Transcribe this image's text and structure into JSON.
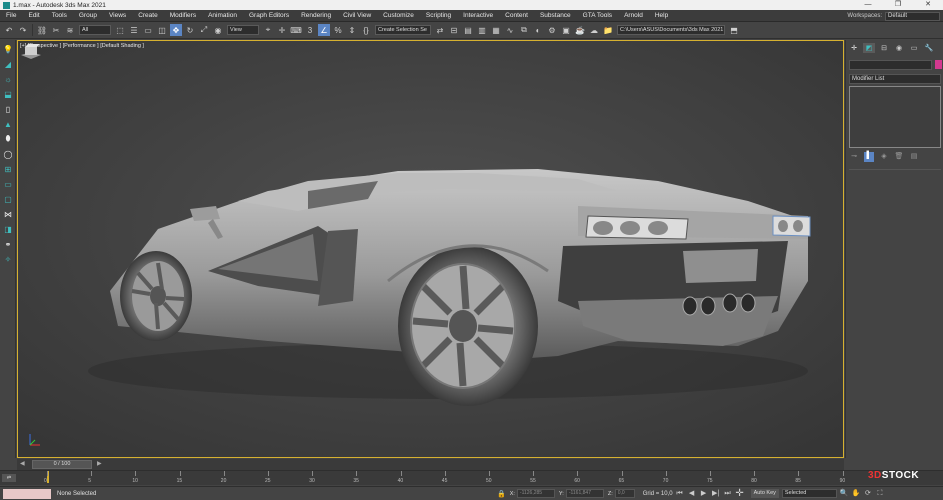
{
  "window": {
    "title": "1.max - Autodesk 3ds Max 2021",
    "controls": [
      "—",
      "❐",
      "✕"
    ]
  },
  "menu": {
    "items": [
      "File",
      "Edit",
      "Tools",
      "Group",
      "Views",
      "Create",
      "Modifiers",
      "Animation",
      "Graph Editors",
      "Rendering",
      "Civil View",
      "Customize",
      "Scripting",
      "Interactive",
      "Content",
      "Substance",
      "GTA Tools",
      "Arnold",
      "Help"
    ],
    "workspaces_label": "Workspaces:",
    "workspaces_value": "Default"
  },
  "toolbar": {
    "filter_select": "All",
    "ref_coord_select": "View",
    "named_selection": "Create Selection Se",
    "project_path": "C:\\Users\\ASUS\\Documents\\3ds Max 2021"
  },
  "viewport": {
    "label": "[+] [Perspective ] [Performance ] [Default Shading ]",
    "border_color": "#d6b130",
    "background": "#3e3e3e"
  },
  "command_panel": {
    "modifier_list": "Modifier List",
    "accent_swatch": "#d4398f"
  },
  "timeline": {
    "frame_display": "0 / 100",
    "ticks": [
      "0",
      "5",
      "10",
      "15",
      "20",
      "25",
      "30",
      "35",
      "40",
      "45",
      "50",
      "55",
      "60",
      "65",
      "70",
      "75",
      "80",
      "85",
      "90"
    ]
  },
  "status": {
    "selection_text": "None Selected",
    "x_label": "X:",
    "x_value": "-1126,285",
    "y_label": "Y:",
    "y_value": "-1161,847",
    "z_label": "Z:",
    "z_value": "0,0",
    "grid_text": "Grid = 10,0",
    "autokey_label": "Auto Key",
    "selected_value": "Selected"
  }
}
